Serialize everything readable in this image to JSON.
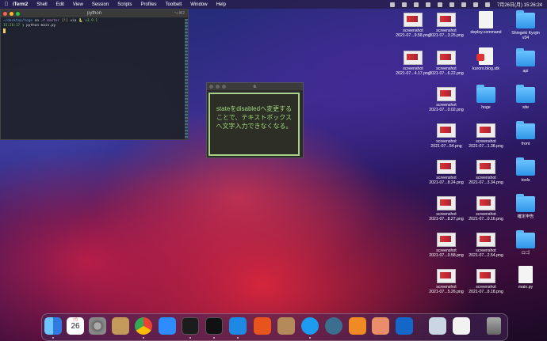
{
  "menubar": {
    "app": "iTerm2",
    "items": [
      "Shell",
      "Edit",
      "View",
      "Session",
      "Scripts",
      "Profiles",
      "Toolbelt",
      "Window",
      "Help"
    ],
    "clock": "7月26日(月)  15:26:24"
  },
  "terminal": {
    "title": "python",
    "shortcut": "⌥⌘2",
    "prompt_path": "~/desktop/hoge",
    "prompt_on": "on",
    "branch": "master",
    "branch_status": "[!]",
    "via": "via",
    "py_version": "v3.9.1",
    "time": "15:26:17",
    "command": "python main.py"
  },
  "tk_window": {
    "title": "tk",
    "message": "stateをdisabledへ変更することで、テキストボックスへ文字入力できなくなる。"
  },
  "desktop_icons": [
    {
      "label": "screenshot\n2021-07...9.58.png"
    },
    {
      "label": "screenshot\n2021-07...3.25.png"
    },
    {
      "label": "deploy.command"
    },
    {
      "label": "Shingeki Kyojin\nv34"
    },
    {
      "label": "screenshot\n2021-07...4.17.png"
    },
    {
      "label": "screenshot\n2021-07...6.22.png"
    },
    {
      "label": "kuroro.blog.stk"
    },
    {
      "label": "api"
    },
    {
      "label": "screenshot\n2021-07...0.02.png"
    },
    {
      "label": "hoge"
    },
    {
      "label": "site"
    },
    {
      "label": "screenshot\n2021-07...54.png"
    },
    {
      "label": "screenshot\n2021-07...1.38.png"
    },
    {
      "label": "front"
    },
    {
      "label": "screenshot\n2021-07...8.24.png"
    },
    {
      "label": "screenshot\n2021-07...3.34.png"
    },
    {
      "label": "tools"
    },
    {
      "label": "screenshot\n2021-07...8.27.png"
    },
    {
      "label": "screenshot\n2021-07...0.16.png"
    },
    {
      "label": "確定申告"
    },
    {
      "label": "screenshot\n2021-07...0.58.png"
    },
    {
      "label": "screenshot\n2021-07...2.54.png"
    },
    {
      "label": "ロゴ"
    },
    {
      "label": "screenshot\n2021-07...5.26.png"
    },
    {
      "label": "screenshot\n2021-07...8.18.png"
    },
    {
      "label": "main.py"
    }
  ],
  "dock": {
    "calendar_month": "7月",
    "calendar_day": "26",
    "apps": [
      "finder",
      "calendar",
      "system-preferences",
      "contacts",
      "chrome",
      "zoom",
      "terminal",
      "iterm",
      "vscode",
      "activity",
      "docker",
      "mysql-workbench",
      "quicktime",
      "sourcetree",
      "figma",
      "infinity",
      "preview",
      "document",
      "trash"
    ]
  }
}
